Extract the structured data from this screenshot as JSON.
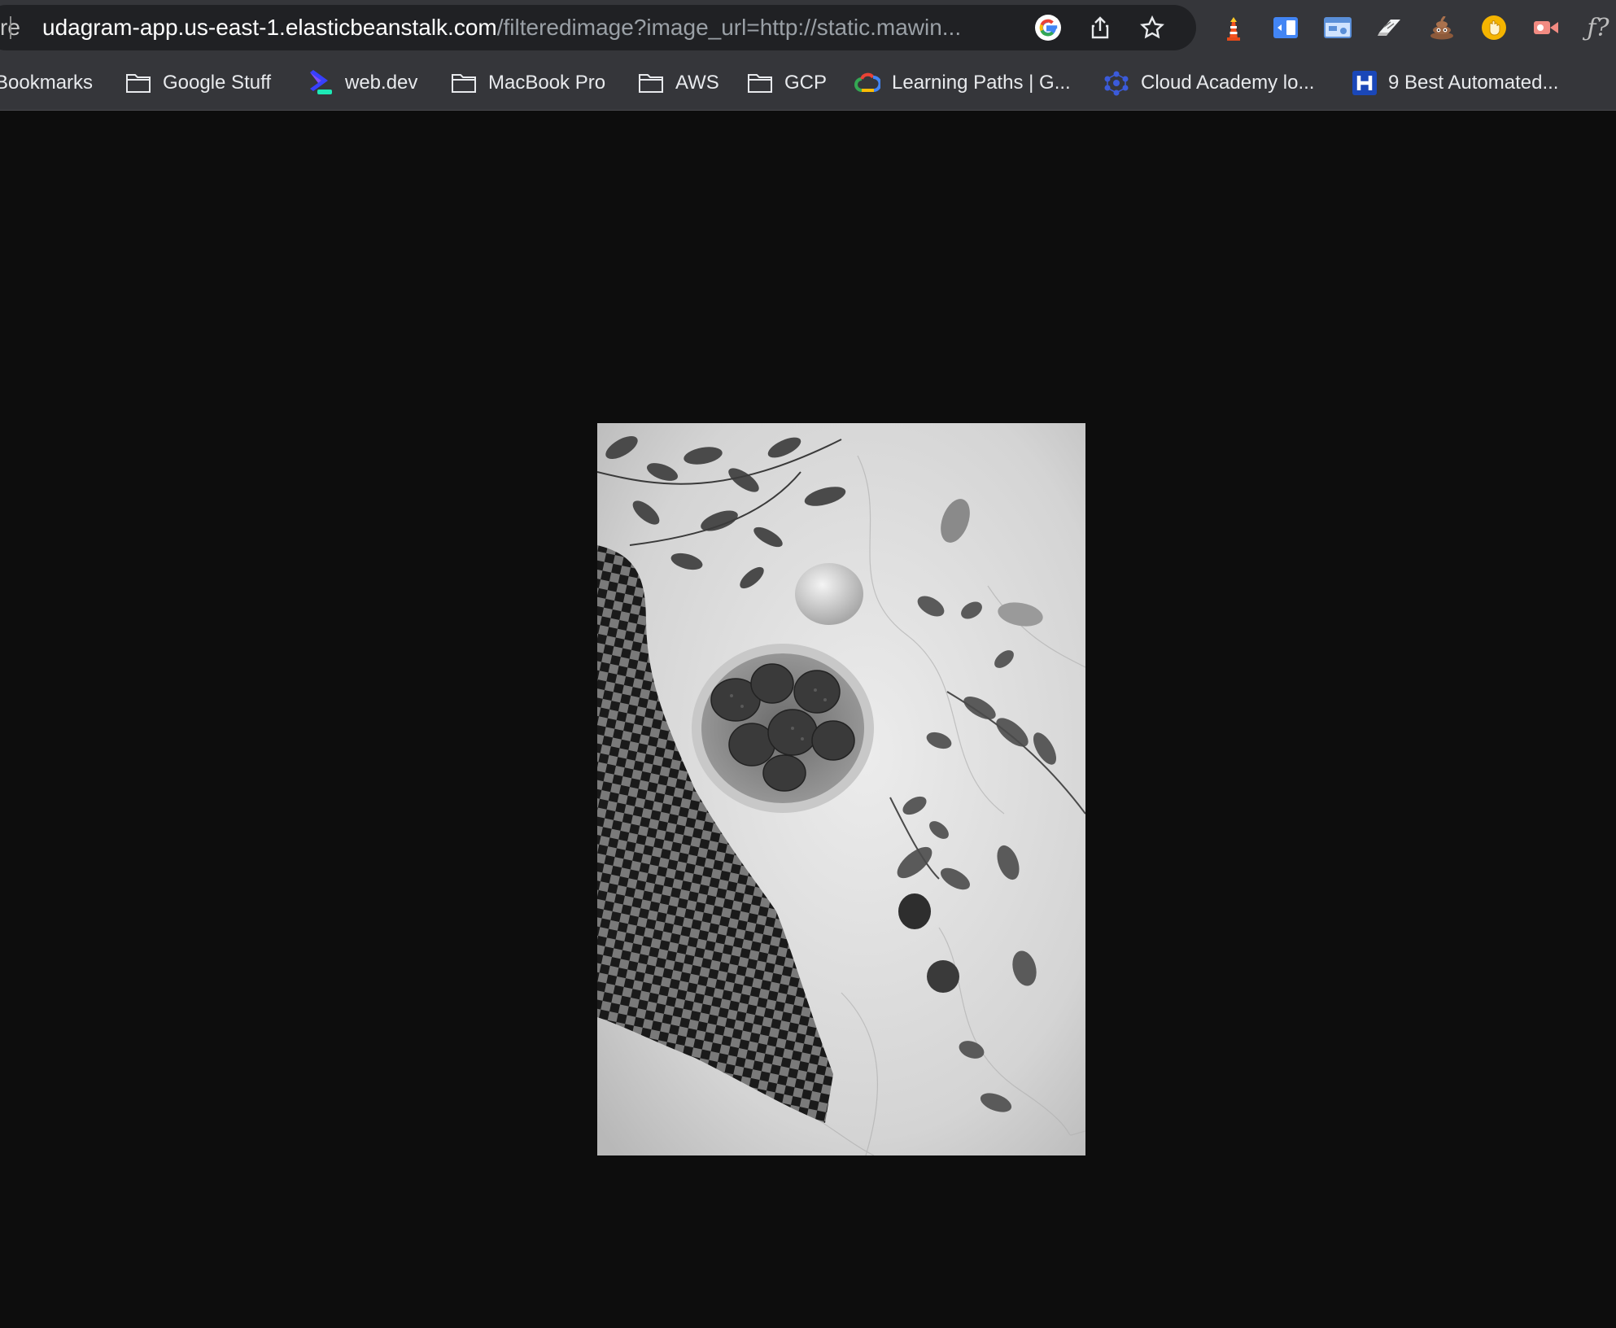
{
  "omnibox": {
    "prefix": "re",
    "url_host": "udagram-app.us-east-1.elasticbeanstalk.com",
    "url_path": "/filteredimage?image_url=http://static.mawin..."
  },
  "bookmarks": [
    {
      "label": "Bookmarks",
      "icon": "none"
    },
    {
      "label": "Google Stuff",
      "icon": "folder-icon"
    },
    {
      "label": "web.dev",
      "icon": "webdev-icon"
    },
    {
      "label": "MacBook Pro",
      "icon": "folder-icon"
    },
    {
      "label": "AWS",
      "icon": "folder-icon"
    },
    {
      "label": "GCP",
      "icon": "folder-icon"
    },
    {
      "label": "Learning Paths | G...",
      "icon": "google-cloud-icon"
    },
    {
      "label": "Cloud Academy lo...",
      "icon": "cloud-academy-icon"
    },
    {
      "label": "9 Best Automated...",
      "icon": "h-logo-icon"
    }
  ],
  "extensions": [
    "lighthouse-icon",
    "split-screen-icon",
    "tab-manager-icon",
    "eraser-icon",
    "poop-emoji-icon",
    "hand-badge-icon",
    "video-record-icon",
    "formula-icon"
  ],
  "image": {
    "alt": "grayscale photo of strawberries in a bowl on marble with checkered cloth",
    "filter": "grayscale"
  },
  "colors": {
    "toolbar": "#35363a",
    "omnibox": "#202124",
    "page_bg": "#0d0d0d"
  }
}
